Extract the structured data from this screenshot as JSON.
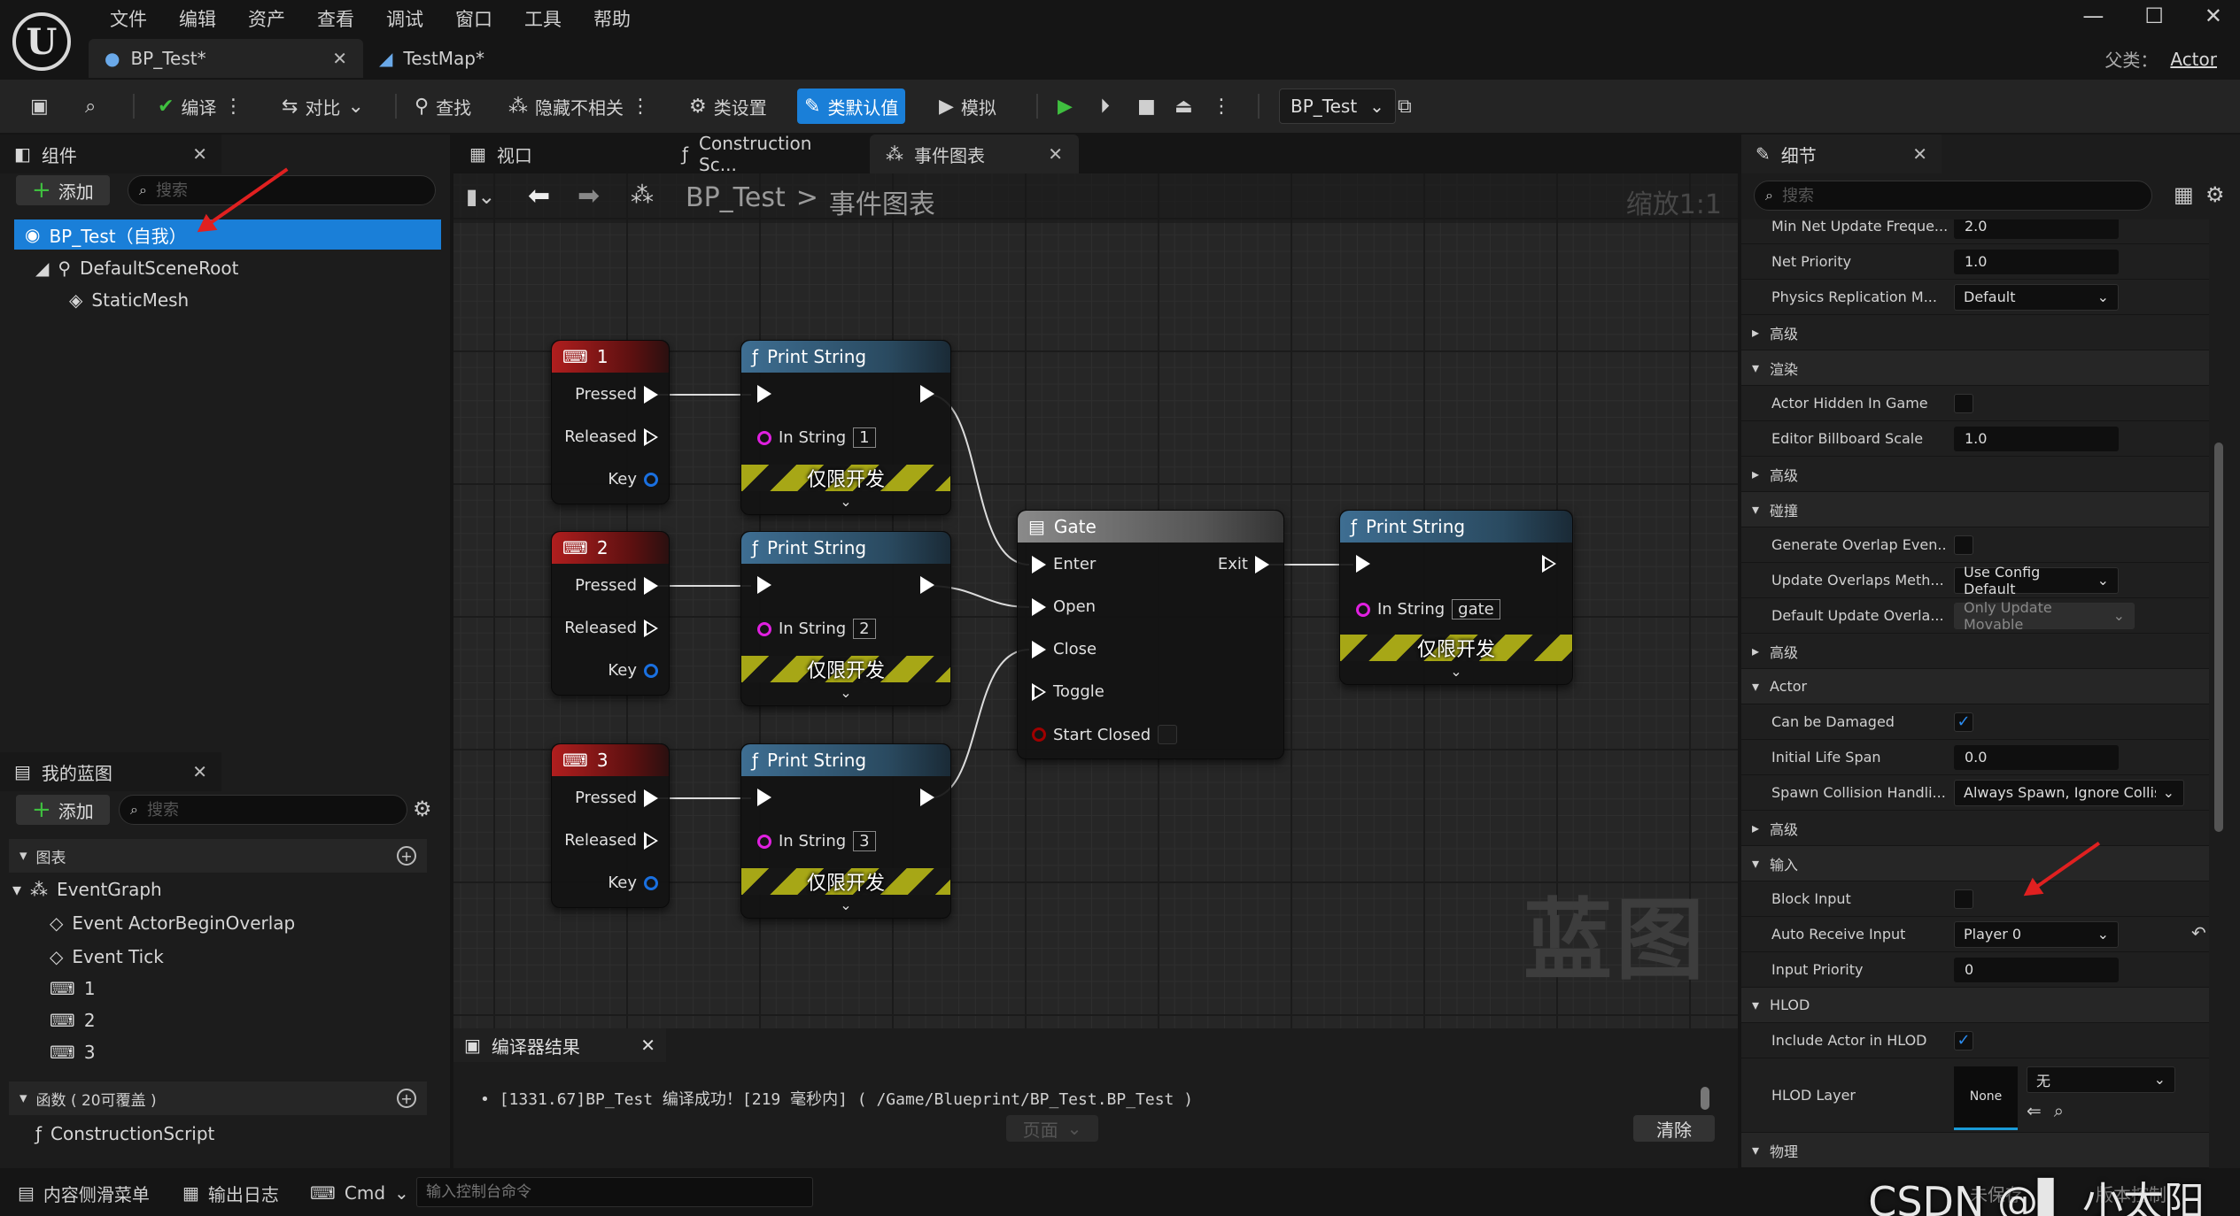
{
  "menu": [
    "文件",
    "编辑",
    "资产",
    "查看",
    "调试",
    "窗口",
    "工具",
    "帮助"
  ],
  "window_controls": [
    "—",
    "☐",
    "✕"
  ],
  "doc_tabs": [
    {
      "label": "BP_Test*",
      "active": true
    },
    {
      "label": "TestMap*",
      "active": false
    }
  ],
  "parent_class": {
    "label": "父类：",
    "value": "Actor"
  },
  "toolbar": {
    "compile": "编译",
    "diff": "对比",
    "find": "查找",
    "hide_unrelated": "隐藏不相关",
    "class_settings": "类设置",
    "class_defaults": "类默认值",
    "simulate": "模拟",
    "debug_object": "BP_Test"
  },
  "components": {
    "title": "组件",
    "add": "添加",
    "search_placeholder": "搜索",
    "items": [
      "BP_Test（自我）",
      "DefaultSceneRoot",
      "StaticMesh"
    ]
  },
  "my_blueprint": {
    "title": "我的蓝图",
    "add": "添加",
    "search_placeholder": "搜索",
    "graphs_section": "图表",
    "graph_items": [
      "EventGraph",
      "Event ActorBeginOverlap",
      "Event Tick",
      "1",
      "2",
      "3"
    ],
    "functions_section": "函数 ( 20可覆盖 )",
    "function_items": [
      "ConstructionScript"
    ]
  },
  "center_tabs": [
    "视口",
    "Construction Sc...",
    "事件图表"
  ],
  "graph": {
    "breadcrumb_root": "BP_Test",
    "breadcrumb_sep": ">",
    "breadcrumb_leaf": "事件图表",
    "zoom": "缩放1:1",
    "watermark": "蓝图"
  },
  "nodes": {
    "key_nodes": [
      {
        "title": "1",
        "pressed": "Pressed",
        "released": "Released",
        "key": "Key"
      },
      {
        "title": "2",
        "pressed": "Pressed",
        "released": "Released",
        "key": "Key"
      },
      {
        "title": "3",
        "pressed": "Pressed",
        "released": "Released",
        "key": "Key"
      }
    ],
    "print_nodes": [
      {
        "title": "Print String",
        "in_string": "In String",
        "value": "1",
        "dev": "仅限开发"
      },
      {
        "title": "Print String",
        "in_string": "In String",
        "value": "2",
        "dev": "仅限开发"
      },
      {
        "title": "Print String",
        "in_string": "In String",
        "value": "3",
        "dev": "仅限开发"
      },
      {
        "title": "Print String",
        "in_string": "In String",
        "value": "gate",
        "dev": "仅限开发"
      }
    ],
    "gate": {
      "title": "Gate",
      "enter": "Enter",
      "exit": "Exit",
      "open": "Open",
      "close": "Close",
      "toggle": "Toggle",
      "start_closed": "Start Closed"
    }
  },
  "compiler": {
    "title": "编译器结果",
    "message": "[1331.67]BP_Test 编译成功！[219 毫秒内] ( /Game/Blueprint/BP_Test.BP_Test )",
    "page": "页面",
    "clear": "清除"
  },
  "details": {
    "title": "细节",
    "search_placeholder": "搜索",
    "rows": {
      "min_net_update": {
        "label": "Min Net Update Freque...",
        "value": "2.0"
      },
      "net_priority": {
        "label": "Net Priority",
        "value": "1.0"
      },
      "physics_rep": {
        "label": "Physics Replication M...",
        "value": "Default"
      },
      "advanced1": "高级",
      "render": "渲染",
      "hidden_in_game": {
        "label": "Actor Hidden In Game"
      },
      "billboard_scale": {
        "label": "Editor Billboard Scale",
        "value": "1.0"
      },
      "advanced2": "高级",
      "collision": "碰撞",
      "gen_overlap": {
        "label": "Generate Overlap Even..."
      },
      "update_overlaps": {
        "label": "Update Overlaps Meth...",
        "value": "Use Config Default"
      },
      "default_update": {
        "label": "Default Update Overla...",
        "value": "Only Update Movable"
      },
      "advanced3": "高级",
      "actor": "Actor",
      "can_be_damaged": {
        "label": "Can be Damaged",
        "checked": true
      },
      "life_span": {
        "label": "Initial Life Span",
        "value": "0.0"
      },
      "spawn_collision": {
        "label": "Spawn Collision Handli...",
        "value": "Always Spawn, Ignore Collisi"
      },
      "advanced4": "高级",
      "input": "输入",
      "block_input": {
        "label": "Block Input"
      },
      "auto_receive": {
        "label": "Auto Receive Input",
        "value": "Player 0"
      },
      "input_priority": {
        "label": "Input Priority",
        "value": "0"
      },
      "hlod": "HLOD",
      "include_hlod": {
        "label": "Include Actor in HLOD",
        "checked": true
      },
      "hlod_layer": {
        "label": "HLOD Layer",
        "thumb": "None",
        "value": "无"
      },
      "physics": "物理"
    }
  },
  "statusbar": {
    "content_drawer": "内容侧滑菜单",
    "output_log": "输出日志",
    "cmd": "Cmd",
    "cmd_placeholder": "输入控制台命令",
    "unsaved": "未保存",
    "source_control": "版本控制",
    "watermark": "CSDN @▌ 小太阳"
  },
  "colors": {
    "accent": "#1a7fd8",
    "red_header": "#b01e1e",
    "blue_header": "#3e6e92",
    "play_green": "#3fbf3f",
    "annotation_arrow": "#e02020"
  }
}
